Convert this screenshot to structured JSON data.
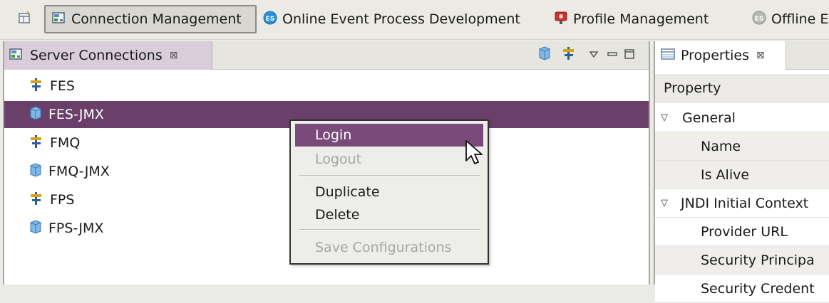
{
  "perspective_bar": {
    "items": [
      {
        "label": "Connection Management",
        "icon": "connection-icon",
        "active": true
      },
      {
        "label": "Online Event Process Development",
        "icon": "es-online-icon"
      },
      {
        "label": "Profile Management",
        "icon": "profile-icon"
      },
      {
        "label": "Offline Ev",
        "icon": "es-offline-icon"
      }
    ]
  },
  "server_connections": {
    "tab_label": "Server Connections",
    "tab_close": "⊠",
    "items": [
      {
        "label": "FES",
        "icon": "server-plug-icon"
      },
      {
        "label": "FES-JMX",
        "icon": "jmx-cube-icon",
        "selected": true
      },
      {
        "label": "FMQ",
        "icon": "server-plug-icon"
      },
      {
        "label": "FMQ-JMX",
        "icon": "jmx-cube-icon"
      },
      {
        "label": "FPS",
        "icon": "server-plug-icon"
      },
      {
        "label": "FPS-JMX",
        "icon": "jmx-cube-icon"
      }
    ]
  },
  "properties": {
    "tab_label": "Properties",
    "tab_close": "⊠",
    "column_header": "Property",
    "rows": [
      {
        "label": "General",
        "group": true
      },
      {
        "label": "Name"
      },
      {
        "label": "Is Alive"
      },
      {
        "label": "JNDI Initial Context",
        "group": true
      },
      {
        "label": "Provider URL"
      },
      {
        "label": "Security Principa"
      },
      {
        "label": "Security Credent"
      }
    ]
  },
  "context_menu": {
    "items": [
      {
        "label": "Login",
        "state": "hover"
      },
      {
        "label": "Logout",
        "state": "disabled"
      },
      {
        "label": "Duplicate",
        "state": "enabled"
      },
      {
        "label": "Delete",
        "state": "enabled"
      },
      {
        "label": "Save Configurations",
        "state": "disabled"
      }
    ]
  },
  "colors": {
    "selection": "#6a3f6a",
    "menu_hover": "#7a4b7a",
    "active_tab": "#d8cdd8"
  }
}
